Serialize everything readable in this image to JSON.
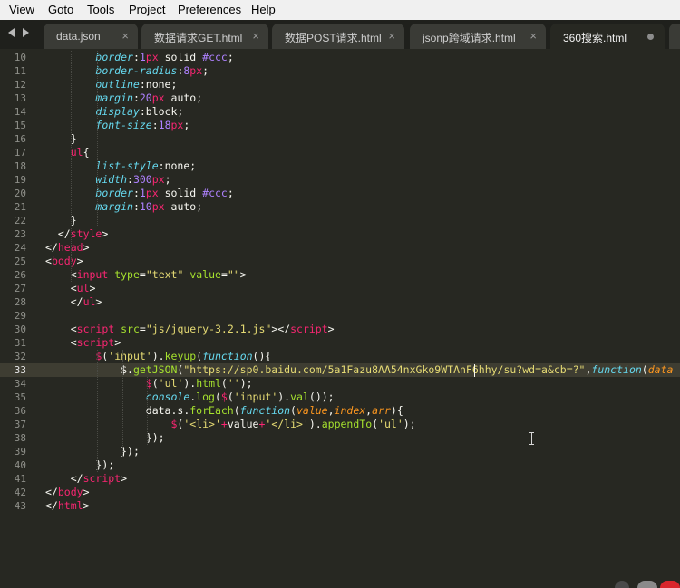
{
  "menu": [
    "View",
    "Goto",
    "Tools",
    "Project",
    "Preferences",
    "Help"
  ],
  "tabs": [
    {
      "label": "data.json",
      "close": "×"
    },
    {
      "label": "数据请求GET.html",
      "close": "×"
    },
    {
      "label": "数据POST请求.html",
      "close": "×"
    },
    {
      "label": "jsonp跨域请求.html",
      "close": "×"
    },
    {
      "label": "360搜索.html",
      "modified": true
    }
  ],
  "current_line": 33,
  "colors": {
    "background": "#272822",
    "keyword": "#f92672",
    "string": "#e6db74",
    "number": "#ae81ff",
    "function": "#a6e22e",
    "type": "#66d9ef",
    "param": "#fd971f"
  },
  "code": [
    {
      "n": 10,
      "tokens": [
        [
          "",
          "        "
        ],
        [
          "it",
          "border"
        ],
        [
          "p",
          ":"
        ],
        [
          "nu",
          "1"
        ],
        [
          "ty",
          "px"
        ],
        [
          "p",
          " solid "
        ],
        [
          "nu",
          "#ccc"
        ],
        [
          "p",
          ";"
        ]
      ]
    },
    {
      "n": 11,
      "tokens": [
        [
          "",
          "        "
        ],
        [
          "it",
          "border-radius"
        ],
        [
          "p",
          ":"
        ],
        [
          "nu",
          "8"
        ],
        [
          "ty",
          "px"
        ],
        [
          "p",
          ";"
        ]
      ]
    },
    {
      "n": 12,
      "tokens": [
        [
          "",
          "        "
        ],
        [
          "it",
          "outline"
        ],
        [
          "p",
          ":none;"
        ]
      ]
    },
    {
      "n": 13,
      "tokens": [
        [
          "",
          "        "
        ],
        [
          "it",
          "margin"
        ],
        [
          "p",
          ":"
        ],
        [
          "nu",
          "20"
        ],
        [
          "ty",
          "px"
        ],
        [
          "p",
          " auto;"
        ]
      ]
    },
    {
      "n": 14,
      "tokens": [
        [
          "",
          "        "
        ],
        [
          "it",
          "display"
        ],
        [
          "p",
          ":block;"
        ]
      ]
    },
    {
      "n": 15,
      "tokens": [
        [
          "",
          "        "
        ],
        [
          "it",
          "font-size"
        ],
        [
          "p",
          ":"
        ],
        [
          "nu",
          "18"
        ],
        [
          "ty",
          "px"
        ],
        [
          "p",
          ";"
        ]
      ]
    },
    {
      "n": 16,
      "tokens": [
        [
          "",
          "    "
        ],
        [
          "p",
          "}"
        ]
      ]
    },
    {
      "n": 17,
      "tokens": [
        [
          "",
          "    "
        ],
        [
          "kw",
          "ul"
        ],
        [
          "p",
          "{"
        ]
      ]
    },
    {
      "n": 18,
      "tokens": [
        [
          "",
          "        "
        ],
        [
          "it",
          "list-style"
        ],
        [
          "p",
          ":none;"
        ]
      ]
    },
    {
      "n": 19,
      "tokens": [
        [
          "",
          "        "
        ],
        [
          "it",
          "width"
        ],
        [
          "p",
          ":"
        ],
        [
          "nu",
          "300"
        ],
        [
          "ty",
          "px"
        ],
        [
          "p",
          ";"
        ]
      ]
    },
    {
      "n": 20,
      "tokens": [
        [
          "",
          "        "
        ],
        [
          "it",
          "border"
        ],
        [
          "p",
          ":"
        ],
        [
          "nu",
          "1"
        ],
        [
          "ty",
          "px"
        ],
        [
          "p",
          " solid "
        ],
        [
          "nu",
          "#ccc"
        ],
        [
          "p",
          ";"
        ]
      ]
    },
    {
      "n": 21,
      "tokens": [
        [
          "",
          "        "
        ],
        [
          "it",
          "margin"
        ],
        [
          "p",
          ":"
        ],
        [
          "nu",
          "10"
        ],
        [
          "ty",
          "px"
        ],
        [
          "p",
          " auto;"
        ]
      ]
    },
    {
      "n": 22,
      "tokens": [
        [
          "",
          "    "
        ],
        [
          "p",
          "}"
        ]
      ]
    },
    {
      "n": 23,
      "tokens": [
        [
          "",
          "  "
        ],
        [
          "p",
          "</"
        ],
        [
          "kw",
          "style"
        ],
        [
          "p",
          ">"
        ]
      ]
    },
    {
      "n": 24,
      "tokens": [
        [
          "p",
          "</"
        ],
        [
          "kw",
          "head"
        ],
        [
          "p",
          ">"
        ]
      ]
    },
    {
      "n": 25,
      "tokens": [
        [
          "p",
          "<"
        ],
        [
          "kw",
          "body"
        ],
        [
          "p",
          ">"
        ]
      ]
    },
    {
      "n": 26,
      "tokens": [
        [
          "",
          "    "
        ],
        [
          "p",
          "<"
        ],
        [
          "kw",
          "input"
        ],
        [
          "p",
          " "
        ],
        [
          "fn",
          "type"
        ],
        [
          "p",
          "="
        ],
        [
          "st",
          "\"text\""
        ],
        [
          "p",
          " "
        ],
        [
          "fn",
          "value"
        ],
        [
          "p",
          "="
        ],
        [
          "st",
          "\"\""
        ],
        [
          "p",
          ">"
        ]
      ]
    },
    {
      "n": 27,
      "tokens": [
        [
          "",
          "    "
        ],
        [
          "p",
          "<"
        ],
        [
          "kw",
          "ul"
        ],
        [
          "p",
          ">"
        ]
      ]
    },
    {
      "n": 28,
      "tokens": [
        [
          "",
          "    "
        ],
        [
          "p",
          "</"
        ],
        [
          "kw",
          "ul"
        ],
        [
          "p",
          ">"
        ]
      ]
    },
    {
      "n": 29,
      "tokens": []
    },
    {
      "n": 30,
      "tokens": [
        [
          "",
          "    "
        ],
        [
          "p",
          "<"
        ],
        [
          "kw",
          "script"
        ],
        [
          "p",
          " "
        ],
        [
          "fn",
          "src"
        ],
        [
          "p",
          "="
        ],
        [
          "st",
          "\"js/jquery-3.2.1.js\""
        ],
        [
          "p",
          "></"
        ],
        [
          "kw",
          "script"
        ],
        [
          "p",
          ">"
        ]
      ]
    },
    {
      "n": 31,
      "tokens": [
        [
          "",
          "    "
        ],
        [
          "p",
          "<"
        ],
        [
          "kw",
          "script"
        ],
        [
          "p",
          ">"
        ]
      ]
    },
    {
      "n": 32,
      "tokens": [
        [
          "",
          "        "
        ],
        [
          "kw",
          "$"
        ],
        [
          "p",
          "("
        ],
        [
          "st",
          "'input'"
        ],
        [
          "p",
          ")."
        ],
        [
          "fn",
          "keyup"
        ],
        [
          "p",
          "("
        ],
        [
          "it2",
          "function"
        ],
        [
          "p",
          "(){"
        ]
      ]
    },
    {
      "n": 33,
      "tokens": [
        [
          "",
          "            "
        ],
        [
          "p",
          "$."
        ],
        [
          "fn",
          "getJSON"
        ],
        [
          "p",
          "("
        ],
        [
          "st",
          "\"https://sp0.baidu.com/5a1Fazu8AA54nxGko9WTAnF6hhy/su?wd=a&cb=?\""
        ],
        [
          "p",
          ","
        ],
        [
          "it2",
          "function"
        ],
        [
          "p",
          "("
        ],
        [
          "pa",
          "data"
        ]
      ]
    },
    {
      "n": 34,
      "tokens": [
        [
          "",
          "                "
        ],
        [
          "kw",
          "$"
        ],
        [
          "p",
          "("
        ],
        [
          "st",
          "'ul'"
        ],
        [
          "p",
          ")."
        ],
        [
          "fn",
          "html"
        ],
        [
          "p",
          "("
        ],
        [
          "st",
          "''"
        ],
        [
          "p",
          ");"
        ]
      ]
    },
    {
      "n": 35,
      "tokens": [
        [
          "",
          "                "
        ],
        [
          "it2",
          "console"
        ],
        [
          "p",
          "."
        ],
        [
          "fn",
          "log"
        ],
        [
          "p",
          "("
        ],
        [
          "kw",
          "$"
        ],
        [
          "p",
          "("
        ],
        [
          "st",
          "'input'"
        ],
        [
          "p",
          ")."
        ],
        [
          "fn",
          "val"
        ],
        [
          "p",
          "());"
        ]
      ]
    },
    {
      "n": 36,
      "tokens": [
        [
          "",
          "                "
        ],
        [
          "p",
          "data.s."
        ],
        [
          "fn",
          "forEach"
        ],
        [
          "p",
          "("
        ],
        [
          "it2",
          "function"
        ],
        [
          "p",
          "("
        ],
        [
          "pa",
          "value"
        ],
        [
          "p",
          ","
        ],
        [
          "pa",
          "index"
        ],
        [
          "p",
          ","
        ],
        [
          "pa",
          "arr"
        ],
        [
          "p",
          "){"
        ]
      ]
    },
    {
      "n": 37,
      "tokens": [
        [
          "",
          "                    "
        ],
        [
          "kw",
          "$"
        ],
        [
          "p",
          "("
        ],
        [
          "st",
          "'<li>'"
        ],
        [
          "kw",
          "+"
        ],
        [
          "p",
          "value"
        ],
        [
          "kw",
          "+"
        ],
        [
          "st",
          "'</li>'"
        ],
        [
          "p",
          ")."
        ],
        [
          "fn",
          "appendTo"
        ],
        [
          "p",
          "("
        ],
        [
          "st",
          "'ul'"
        ],
        [
          "p",
          ");"
        ]
      ]
    },
    {
      "n": 38,
      "tokens": [
        [
          "",
          "                "
        ],
        [
          "p",
          "});"
        ]
      ]
    },
    {
      "n": 39,
      "tokens": [
        [
          "",
          "            "
        ],
        [
          "p",
          "});"
        ]
      ]
    },
    {
      "n": 40,
      "tokens": [
        [
          "",
          "        "
        ],
        [
          "p",
          "});"
        ]
      ]
    },
    {
      "n": 41,
      "tokens": [
        [
          "",
          "    "
        ],
        [
          "p",
          "</"
        ],
        [
          "kw",
          "script"
        ],
        [
          "p",
          ">"
        ]
      ]
    },
    {
      "n": 42,
      "tokens": [
        [
          "p",
          "</"
        ],
        [
          "kw",
          "body"
        ],
        [
          "p",
          ">"
        ]
      ]
    },
    {
      "n": 43,
      "tokens": [
        [
          "p",
          "</"
        ],
        [
          "kw",
          "html"
        ],
        [
          "p",
          ">"
        ]
      ]
    }
  ]
}
